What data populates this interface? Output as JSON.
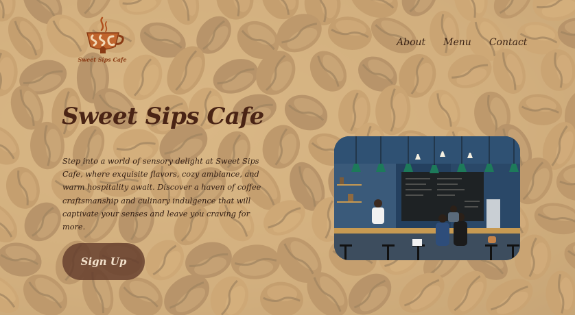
{
  "site": {
    "logo_text": "Sweet Sips Cafe"
  },
  "nav": {
    "items": [
      {
        "label": "About"
      },
      {
        "label": "Menu"
      },
      {
        "label": "Contact"
      }
    ]
  },
  "hero": {
    "title": "Sweet Sips Cafe",
    "description": "Step into a world of sensory delight at Sweet Sips Cafe, where exquisite flavors, cozy ambiance, and warm hospitality await. Discover a haven of coffee craftsmanship and culinary indulgence that will captivate your senses and leave you craving for more.",
    "cta_label": "Sign Up"
  },
  "icons": {
    "logo": "cafe-logo-icon",
    "photo": "cafe-interior-photo"
  },
  "colors": {
    "background": "#d7b483",
    "title": "#4a2415",
    "button": "#5f3728",
    "button_text": "#f3e2cc",
    "logo_accent": "#b0501e"
  }
}
